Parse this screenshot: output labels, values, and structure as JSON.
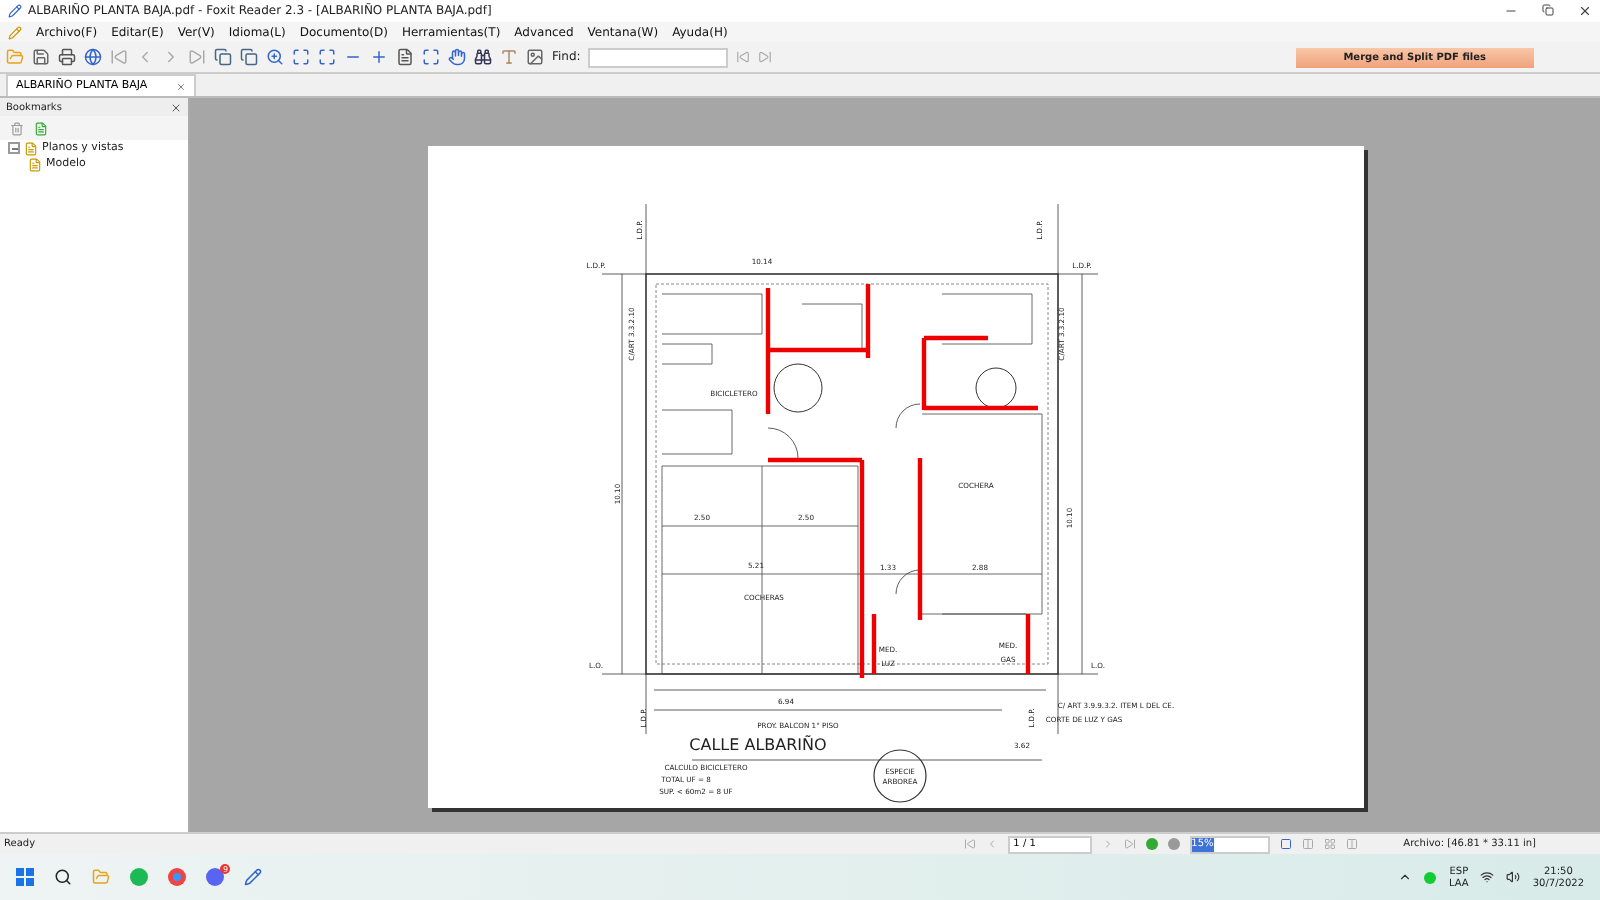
{
  "window": {
    "title": "ALBARIÑO PLANTA BAJA.pdf - Foxit Reader 2.3 - [ALBARIÑO PLANTA BAJA.pdf]"
  },
  "menu": [
    "Archivo(F)",
    "Editar(E)",
    "Ver(V)",
    "Idioma(L)",
    "Documento(D)",
    "Herramientas(T)",
    "Advanced",
    "Ventana(W)",
    "Ayuda(H)"
  ],
  "toolbar": {
    "find_label": "Find:",
    "banner": "Merge and Split PDF files"
  },
  "tabs": [
    {
      "label": "ALBARIÑO PLANTA BAJA",
      "selected": true
    }
  ],
  "sidebar": {
    "title": "Bookmarks",
    "items": [
      {
        "label": "Planos y vistas",
        "expanded": true,
        "children": [
          {
            "label": "Modelo"
          }
        ]
      }
    ]
  },
  "plan": {
    "labels": [
      "L.D.P.",
      "L.D.P.",
      "10.14",
      "BICICLETERO",
      "COCHERA",
      "COCHERAS",
      "2.50",
      "2.50",
      "5.21",
      "1.33",
      "2.88",
      "MED.",
      "LUZ",
      "MED.",
      "GAS",
      "L.O.",
      "L.O.",
      "6.94",
      "PROY. BALCON 1° PISO",
      "CALLE ALBARIÑO",
      "CALCULO BICICLETERO",
      "TOTAL UF = 8",
      "SUP. < 60m2 = 8 UF",
      "3.62",
      "C/ ART 3.9.9.3.2. ITEM L DEL CE.",
      "CORTE DE LUZ Y GAS",
      "10.10",
      "10.10",
      "C/ART 3.3.2.10",
      "C/ART 3.3.2.10",
      "ESPECIE",
      "ARBOREA",
      "L.D.P.",
      "L.D.P.",
      "L.D.P.",
      "L.D.P."
    ]
  },
  "status_bar": {
    "text": "Ready",
    "page": "1 / 1",
    "zoom": "15%",
    "size": "Archivo: [46.81 * 33.11 in]"
  },
  "taskbar": {
    "badge": "9",
    "language": "ESP",
    "layout": "LAA",
    "time": "21:50",
    "date": "30/7/2022"
  }
}
